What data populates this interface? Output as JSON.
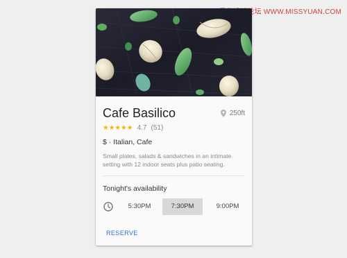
{
  "watermark": "思缘设计论坛 WWW.MISSYUAN.COM",
  "card": {
    "title": "Cafe Basilico",
    "distance": "250ft",
    "rating": {
      "stars": "★★★★★",
      "score": "4.7",
      "count": "(51)",
      "value": 4.7,
      "max": 5
    },
    "category": "$ · Italian, Cafe",
    "description": "Small plates, salads & sandwiches in an intimate setting with 12 indoor seats plus patio seating.",
    "availability_title": "Tonight's availability",
    "times": [
      "5:30PM",
      "7:30PM",
      "9:00PM"
    ],
    "selected_time_index": 1,
    "reserve_label": "RESERVE"
  },
  "colors": {
    "accent": "#2d6fd6",
    "star": "#f3b400",
    "selected_slot": "#d8d8d8",
    "hero_background": "#1f1f2b"
  },
  "icons": {
    "location": "map-pin-icon",
    "clock": "clock-icon"
  }
}
